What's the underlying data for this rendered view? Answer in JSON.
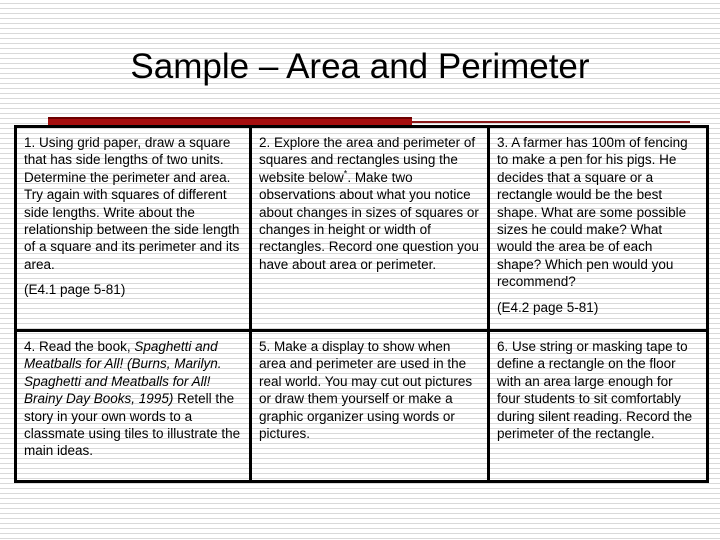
{
  "slide": {
    "title": "Sample – Area and Perimeter",
    "accent_color": "#a50e0e",
    "rule_color": "#8b1a1a",
    "text_color": "#000000",
    "background": "striped-white"
  },
  "table": {
    "columns": 3,
    "rows": 2,
    "cells": [
      {
        "id": "cell-1",
        "number": "1.",
        "body": "1. Using grid paper, draw a square that has side lengths of two units. Determine the perimeter and area. Try again with squares of different side lengths. Write about the relationship between the side length of a square and its perimeter and its area.",
        "reference": "(E4.1 page 5-81)"
      },
      {
        "id": "cell-2",
        "number": "2.",
        "body_before_marker": "2.  Explore the area and perimeter of squares and rectangles using the website below",
        "marker": "*",
        "body_after_marker": ". Make two observations about what you notice about changes in sizes of squares or changes in height or width of rectangles. Record one question you have about area or perimeter.",
        "reference": ""
      },
      {
        "id": "cell-3",
        "number": "3.",
        "body": "3. A farmer has 100m of fencing to make a pen for his pigs. He decides that a square or a rectangle would be the best shape. What are some possible sizes he could make? What would the area be of each shape? Which pen would you recommend?",
        "reference": "(E4.2 page 5-81)"
      },
      {
        "id": "cell-4",
        "number": "4.",
        "body_part1": "4. Read the book, ",
        "body_italic": "Spaghetti and Meatballs for All! (Burns, Marilyn. Spaghetti and Meatballs for All!  Brainy Day Books, 1995)",
        "body_part2": " Retell the story in your own words to a classmate using tiles to illustrate the main ideas.",
        "reference": ""
      },
      {
        "id": "cell-5",
        "number": "5.",
        "body": "5. Make a display to show when area and perimeter are used in the real world. You may cut out pictures or draw them yourself or make a graphic organizer using words or pictures.",
        "reference": ""
      },
      {
        "id": "cell-6",
        "number": "6.",
        "body": "6. Use string or masking tape to define a rectangle on the floor with an area large enough for four students to sit comfortably during silent reading. Record the perimeter of the rectangle.",
        "reference": ""
      }
    ]
  }
}
